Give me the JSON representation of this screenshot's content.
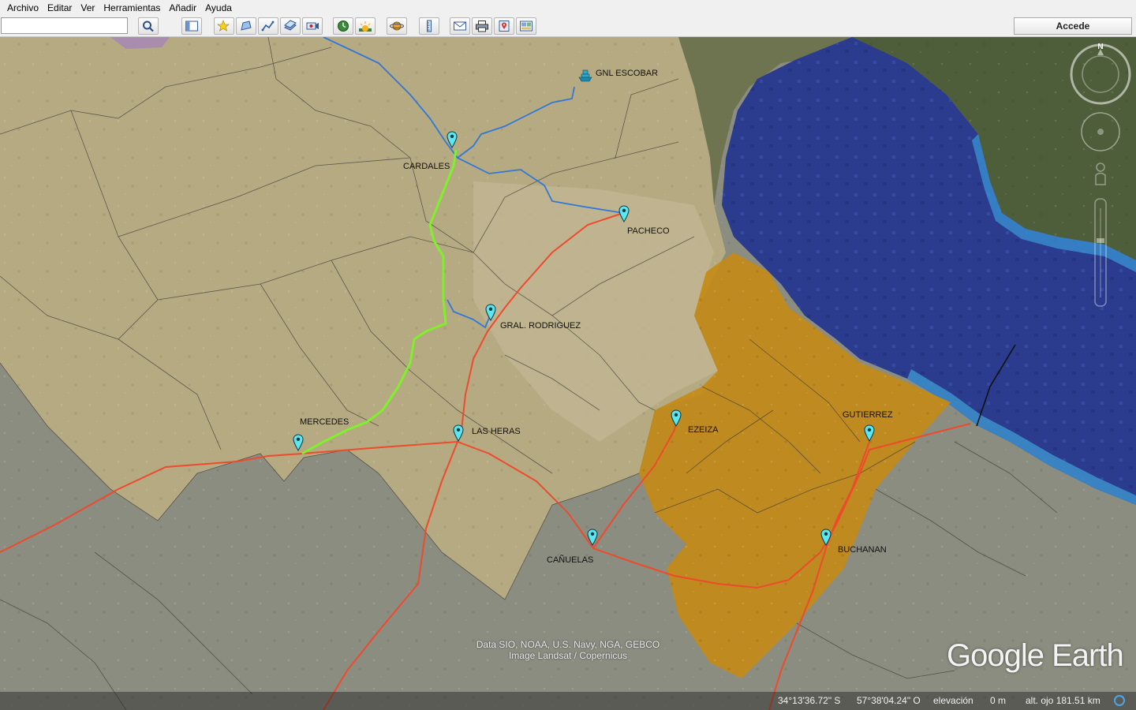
{
  "menu": {
    "items": [
      "Archivo",
      "Editar",
      "Ver",
      "Herramientas",
      "Añadir",
      "Ayuda"
    ]
  },
  "toolbar": {
    "search_value": "",
    "login_label": "Accede",
    "buttons": [
      "search-icon",
      "sidebar-toggle-icon",
      "placemark-icon",
      "polygon-icon",
      "path-icon",
      "image-overlay-icon",
      "record-tour-icon",
      "historical-imagery-icon",
      "sunlight-icon",
      "planet-icon",
      "ruler-icon",
      "email-icon",
      "print-icon",
      "maps-icon",
      "save-image-icon"
    ]
  },
  "map": {
    "places": [
      {
        "id": "gnl-escobar",
        "label": "GNL ESCOBAR",
        "icon": "ship-icon"
      },
      {
        "id": "cardales",
        "label": "CARDALES",
        "icon": "placemark-icon"
      },
      {
        "id": "pacheco",
        "label": "PACHECO",
        "icon": "placemark-icon"
      },
      {
        "id": "gral-rodriguez",
        "label": "GRAL. RODRIGUEZ",
        "icon": "placemark-icon"
      },
      {
        "id": "mercedes",
        "label": "MERCEDES",
        "icon": "placemark-icon"
      },
      {
        "id": "las-heras",
        "label": "LAS HERAS",
        "icon": "placemark-icon"
      },
      {
        "id": "ezeiza",
        "label": "EZEIZA",
        "icon": "placemark-icon"
      },
      {
        "id": "gutierrez",
        "label": "GUTIERREZ",
        "icon": "placemark-icon"
      },
      {
        "id": "canuelas",
        "label": "CAÑUELAS",
        "icon": "placemark-icon"
      },
      {
        "id": "buchanan",
        "label": "BUCHANAN",
        "icon": "placemark-icon"
      }
    ],
    "attribution": {
      "line1": "Data SIO, NOAA, U.S. Navy, NGA, GEBCO",
      "line2": "Image Landsat / Copernicus"
    },
    "logo_text": "Google Earth",
    "compass_label": "N",
    "colors": {
      "pipeline_blue": "#2f78d8",
      "pipeline_red": "#ee4a2c",
      "pipeline_green": "#7ef22a",
      "highlight_orange": "#c98d16",
      "water": "#2a3c8e",
      "marker": "#5ce6f0"
    }
  },
  "status": {
    "latitude": "34°13'36.72\" S",
    "longitude": "57°38'04.24\" O",
    "elevation_label": "elevación",
    "elevation_value": "0 m",
    "eye_alt": "alt. ojo 181.51 km"
  }
}
